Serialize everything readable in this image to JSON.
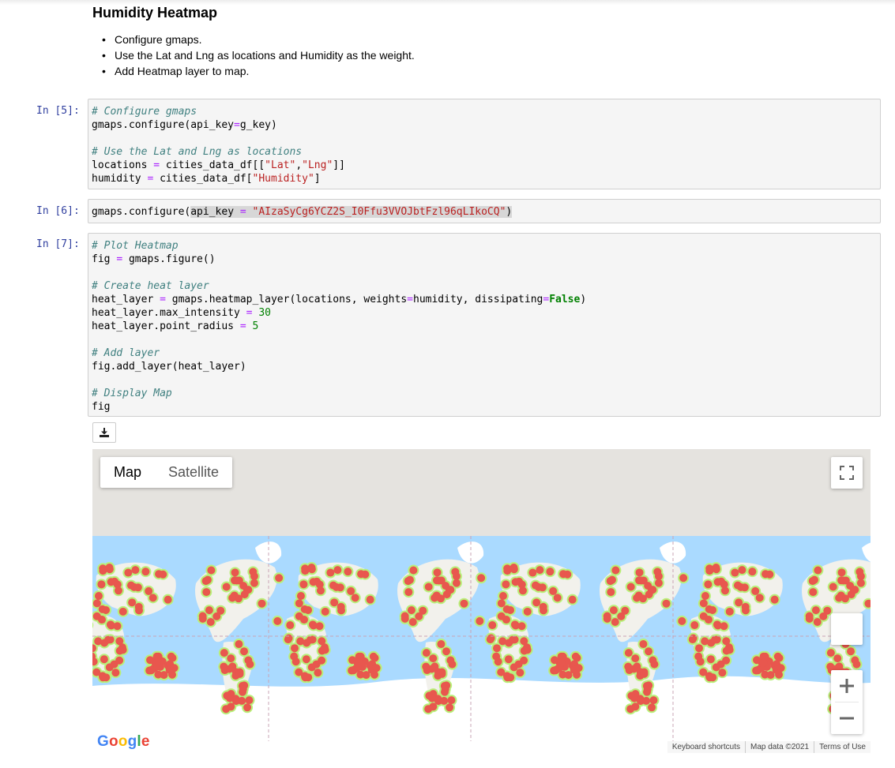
{
  "markdown": {
    "title": "Humidity Heatmap",
    "bullets": [
      "Configure gmaps.",
      "Use the Lat and Lng as locations and Humidity as the weight.",
      "Add Heatmap layer to map."
    ]
  },
  "cells": [
    {
      "prompt": "In [5]:",
      "lines": [
        [
          {
            "t": "# Configure gmaps",
            "c": "cm"
          }
        ],
        [
          {
            "t": "gmaps.configure(api_key"
          },
          {
            "t": "=",
            "c": "op"
          },
          {
            "t": "g_key)"
          }
        ],
        [],
        [
          {
            "t": "# Use the Lat and Lng as locations",
            "c": "cm"
          }
        ],
        [
          {
            "t": "locations "
          },
          {
            "t": "=",
            "c": "op"
          },
          {
            "t": " cities_data_df[["
          },
          {
            "t": "\"Lat\"",
            "c": "st"
          },
          {
            "t": ","
          },
          {
            "t": "\"Lng\"",
            "c": "st"
          },
          {
            "t": "]]"
          }
        ],
        [
          {
            "t": "humidity "
          },
          {
            "t": "=",
            "c": "op"
          },
          {
            "t": " cities_data_df["
          },
          {
            "t": "\"Humidity\"",
            "c": "st"
          },
          {
            "t": "]"
          }
        ]
      ]
    },
    {
      "prompt": "In [6]:",
      "lines": [
        [
          {
            "t": "gmaps.configure("
          },
          {
            "t": "api_key ",
            "c": "sel"
          },
          {
            "t": "=",
            "c": "op sel"
          },
          {
            "t": " ",
            "c": "sel"
          },
          {
            "t": "\"AIzaSyCg6YCZ2S_I0Ffu3VVOJbtFzl96qLIkoCQ\"",
            "c": "st sel"
          },
          {
            "t": ")",
            "c": "sel"
          }
        ]
      ]
    },
    {
      "prompt": "In [7]:",
      "lines": [
        [
          {
            "t": "# Plot Heatmap",
            "c": "cm"
          }
        ],
        [
          {
            "t": "fig "
          },
          {
            "t": "=",
            "c": "op"
          },
          {
            "t": " gmaps.figure()"
          }
        ],
        [],
        [
          {
            "t": "# Create heat layer",
            "c": "cm"
          }
        ],
        [
          {
            "t": "heat_layer "
          },
          {
            "t": "=",
            "c": "op"
          },
          {
            "t": " gmaps.heatmap_layer(locations, weights"
          },
          {
            "t": "=",
            "c": "op"
          },
          {
            "t": "humidity, dissipating"
          },
          {
            "t": "=",
            "c": "op"
          },
          {
            "t": "False",
            "c": "kw"
          },
          {
            "t": ")"
          }
        ],
        [
          {
            "t": "heat_layer.max_intensity "
          },
          {
            "t": "=",
            "c": "op"
          },
          {
            "t": " "
          },
          {
            "t": "30",
            "c": "nm"
          }
        ],
        [
          {
            "t": "heat_layer.point_radius "
          },
          {
            "t": "=",
            "c": "op"
          },
          {
            "t": " "
          },
          {
            "t": "5",
            "c": "nm"
          }
        ],
        [],
        [
          {
            "t": "# Add layer",
            "c": "cm"
          }
        ],
        [
          {
            "t": "fig.add_layer(heat_layer)"
          }
        ],
        [],
        [
          {
            "t": "# Display Map",
            "c": "cm"
          }
        ],
        [
          {
            "t": "fig"
          }
        ]
      ]
    }
  ],
  "map": {
    "type_buttons": [
      "Map",
      "Satellite"
    ],
    "active_type": "Map",
    "attribution": [
      "Keyboard shortcuts",
      "Map data ©2021",
      "Terms of Use"
    ],
    "logo_letters": [
      "G",
      "o",
      "o",
      "g",
      "l",
      "e"
    ],
    "colors": {
      "ocean": "#aadaff",
      "land": "#f2f1ec",
      "ice": "#ffffff",
      "heat_core": "#e8574e",
      "heat_edge": "#b9f07a",
      "off_map": "#e5e3df"
    },
    "icons": [
      "download-icon",
      "fullscreen-icon",
      "zoom-in-icon",
      "zoom-out-icon"
    ]
  }
}
